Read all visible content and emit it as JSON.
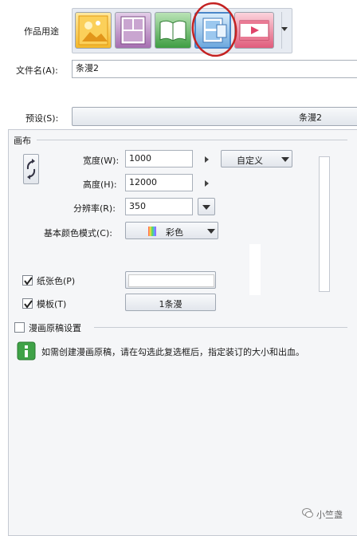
{
  "usage": {
    "label": "作品用途",
    "icons": [
      "illustration-icon",
      "comic-page-icon",
      "book-icon",
      "webtoon-icon",
      "animation-icon"
    ]
  },
  "filename": {
    "label": "文件名(A):",
    "value": "条漫2"
  },
  "preset": {
    "label": "预设(S):",
    "value": "条漫2"
  },
  "canvas": {
    "section_label": "画布",
    "width_label": "宽度(W):",
    "width_value": "1000",
    "height_label": "高度(H):",
    "height_value": "12000",
    "resolution_label": "分辨率(R):",
    "resolution_value": "350",
    "unit_value": "自定义",
    "color_mode_label": "基本颜色模式(C):",
    "color_mode_value": "彩色",
    "paper_color_label": "纸张色(P)",
    "paper_color_checked": true,
    "paper_color_swatch": "#ffffff",
    "template_label": "模板(T)",
    "template_checked": true,
    "template_value": "1条漫"
  },
  "manuscript": {
    "label": "漫画原稿设置",
    "checked": false,
    "info": "如需创建漫画原稿，请在勾选此复选框后，指定装订的大小和出血。"
  },
  "watermark": {
    "text": "小竺盏"
  },
  "colors": {
    "selected_border": "#4a86c8",
    "annotation_circle": "#c42222"
  }
}
